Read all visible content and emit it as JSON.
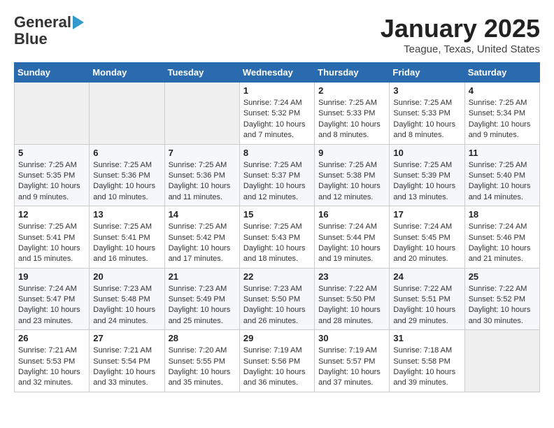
{
  "header": {
    "logo_line1": "General",
    "logo_line2": "Blue",
    "title": "January 2025",
    "subtitle": "Teague, Texas, United States"
  },
  "days_of_week": [
    "Sunday",
    "Monday",
    "Tuesday",
    "Wednesday",
    "Thursday",
    "Friday",
    "Saturday"
  ],
  "weeks": [
    [
      {
        "day": "",
        "info": ""
      },
      {
        "day": "",
        "info": ""
      },
      {
        "day": "",
        "info": ""
      },
      {
        "day": "1",
        "info": "Sunrise: 7:24 AM\nSunset: 5:32 PM\nDaylight: 10 hours\nand 7 minutes."
      },
      {
        "day": "2",
        "info": "Sunrise: 7:25 AM\nSunset: 5:33 PM\nDaylight: 10 hours\nand 8 minutes."
      },
      {
        "day": "3",
        "info": "Sunrise: 7:25 AM\nSunset: 5:33 PM\nDaylight: 10 hours\nand 8 minutes."
      },
      {
        "day": "4",
        "info": "Sunrise: 7:25 AM\nSunset: 5:34 PM\nDaylight: 10 hours\nand 9 minutes."
      }
    ],
    [
      {
        "day": "5",
        "info": "Sunrise: 7:25 AM\nSunset: 5:35 PM\nDaylight: 10 hours\nand 9 minutes."
      },
      {
        "day": "6",
        "info": "Sunrise: 7:25 AM\nSunset: 5:36 PM\nDaylight: 10 hours\nand 10 minutes."
      },
      {
        "day": "7",
        "info": "Sunrise: 7:25 AM\nSunset: 5:36 PM\nDaylight: 10 hours\nand 11 minutes."
      },
      {
        "day": "8",
        "info": "Sunrise: 7:25 AM\nSunset: 5:37 PM\nDaylight: 10 hours\nand 12 minutes."
      },
      {
        "day": "9",
        "info": "Sunrise: 7:25 AM\nSunset: 5:38 PM\nDaylight: 10 hours\nand 12 minutes."
      },
      {
        "day": "10",
        "info": "Sunrise: 7:25 AM\nSunset: 5:39 PM\nDaylight: 10 hours\nand 13 minutes."
      },
      {
        "day": "11",
        "info": "Sunrise: 7:25 AM\nSunset: 5:40 PM\nDaylight: 10 hours\nand 14 minutes."
      }
    ],
    [
      {
        "day": "12",
        "info": "Sunrise: 7:25 AM\nSunset: 5:41 PM\nDaylight: 10 hours\nand 15 minutes."
      },
      {
        "day": "13",
        "info": "Sunrise: 7:25 AM\nSunset: 5:41 PM\nDaylight: 10 hours\nand 16 minutes."
      },
      {
        "day": "14",
        "info": "Sunrise: 7:25 AM\nSunset: 5:42 PM\nDaylight: 10 hours\nand 17 minutes."
      },
      {
        "day": "15",
        "info": "Sunrise: 7:25 AM\nSunset: 5:43 PM\nDaylight: 10 hours\nand 18 minutes."
      },
      {
        "day": "16",
        "info": "Sunrise: 7:24 AM\nSunset: 5:44 PM\nDaylight: 10 hours\nand 19 minutes."
      },
      {
        "day": "17",
        "info": "Sunrise: 7:24 AM\nSunset: 5:45 PM\nDaylight: 10 hours\nand 20 minutes."
      },
      {
        "day": "18",
        "info": "Sunrise: 7:24 AM\nSunset: 5:46 PM\nDaylight: 10 hours\nand 21 minutes."
      }
    ],
    [
      {
        "day": "19",
        "info": "Sunrise: 7:24 AM\nSunset: 5:47 PM\nDaylight: 10 hours\nand 23 minutes."
      },
      {
        "day": "20",
        "info": "Sunrise: 7:23 AM\nSunset: 5:48 PM\nDaylight: 10 hours\nand 24 minutes."
      },
      {
        "day": "21",
        "info": "Sunrise: 7:23 AM\nSunset: 5:49 PM\nDaylight: 10 hours\nand 25 minutes."
      },
      {
        "day": "22",
        "info": "Sunrise: 7:23 AM\nSunset: 5:50 PM\nDaylight: 10 hours\nand 26 minutes."
      },
      {
        "day": "23",
        "info": "Sunrise: 7:22 AM\nSunset: 5:50 PM\nDaylight: 10 hours\nand 28 minutes."
      },
      {
        "day": "24",
        "info": "Sunrise: 7:22 AM\nSunset: 5:51 PM\nDaylight: 10 hours\nand 29 minutes."
      },
      {
        "day": "25",
        "info": "Sunrise: 7:22 AM\nSunset: 5:52 PM\nDaylight: 10 hours\nand 30 minutes."
      }
    ],
    [
      {
        "day": "26",
        "info": "Sunrise: 7:21 AM\nSunset: 5:53 PM\nDaylight: 10 hours\nand 32 minutes."
      },
      {
        "day": "27",
        "info": "Sunrise: 7:21 AM\nSunset: 5:54 PM\nDaylight: 10 hours\nand 33 minutes."
      },
      {
        "day": "28",
        "info": "Sunrise: 7:20 AM\nSunset: 5:55 PM\nDaylight: 10 hours\nand 35 minutes."
      },
      {
        "day": "29",
        "info": "Sunrise: 7:19 AM\nSunset: 5:56 PM\nDaylight: 10 hours\nand 36 minutes."
      },
      {
        "day": "30",
        "info": "Sunrise: 7:19 AM\nSunset: 5:57 PM\nDaylight: 10 hours\nand 37 minutes."
      },
      {
        "day": "31",
        "info": "Sunrise: 7:18 AM\nSunset: 5:58 PM\nDaylight: 10 hours\nand 39 minutes."
      },
      {
        "day": "",
        "info": ""
      }
    ]
  ]
}
